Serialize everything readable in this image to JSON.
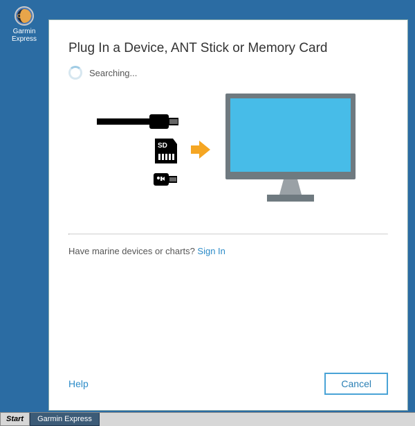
{
  "desktop": {
    "icon_label": "Garmin\nExpress"
  },
  "panel": {
    "title": "Plug In a Device, ANT Stick or Memory Card",
    "status": "Searching...",
    "marine_text": "Have marine devices or charts? ",
    "signin_label": "Sign In",
    "help_label": "Help",
    "cancel_label": "Cancel"
  },
  "taskbar": {
    "start_label": "Start",
    "task1_label": "Garmin Express"
  }
}
